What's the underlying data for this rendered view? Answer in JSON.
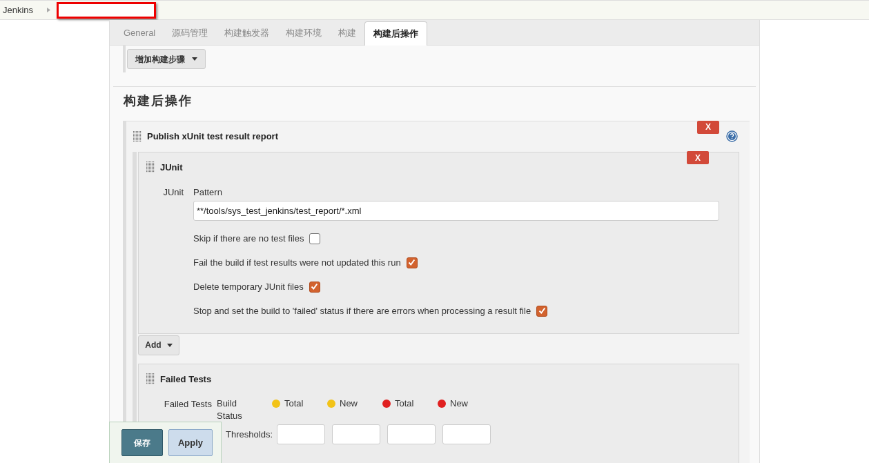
{
  "breadcrumb": {
    "items": [
      "Jenkins"
    ]
  },
  "tabs": [
    {
      "label": "General",
      "selected": false
    },
    {
      "label": "源码管理",
      "selected": false
    },
    {
      "label": "构建触发器",
      "selected": false
    },
    {
      "label": "构建环境",
      "selected": false
    },
    {
      "label": "构建",
      "selected": false
    },
    {
      "label": "构建后操作",
      "selected": true
    }
  ],
  "add_build_step_button": "增加构建步骤",
  "section_heading": "构建后操作",
  "publisher": {
    "title": "Publish xUnit test result report",
    "delete_label": "X",
    "junit": {
      "title": "JUnit",
      "delete_label": "X",
      "label": "JUnit",
      "pattern_label": "Pattern",
      "pattern_value": "**/tools/sys_test_jenkins/test_report/*.xml",
      "options": [
        {
          "label": "Skip if there are no test files",
          "checked": false
        },
        {
          "label": "Fail the build if test results were not updated this run",
          "checked": true
        },
        {
          "label": "Delete temporary JUnit files",
          "checked": true
        },
        {
          "label": "Stop and set the build to 'failed' status if there are errors when processing a result file",
          "checked": true
        }
      ]
    },
    "add_button": "Add",
    "failed_tests": {
      "title": "Failed Tests",
      "label": "Failed Tests",
      "build_status": "Build Status",
      "thresholds": [
        {
          "label": "Total",
          "color": "#f2c318"
        },
        {
          "label": "New",
          "color": "#f2c318"
        },
        {
          "label": "Total",
          "color": "#e02020"
        },
        {
          "label": "New",
          "color": "#e02020"
        }
      ],
      "thresholds_label": "Thresholds:"
    }
  },
  "footer": {
    "save": "保存",
    "apply": "Apply"
  }
}
